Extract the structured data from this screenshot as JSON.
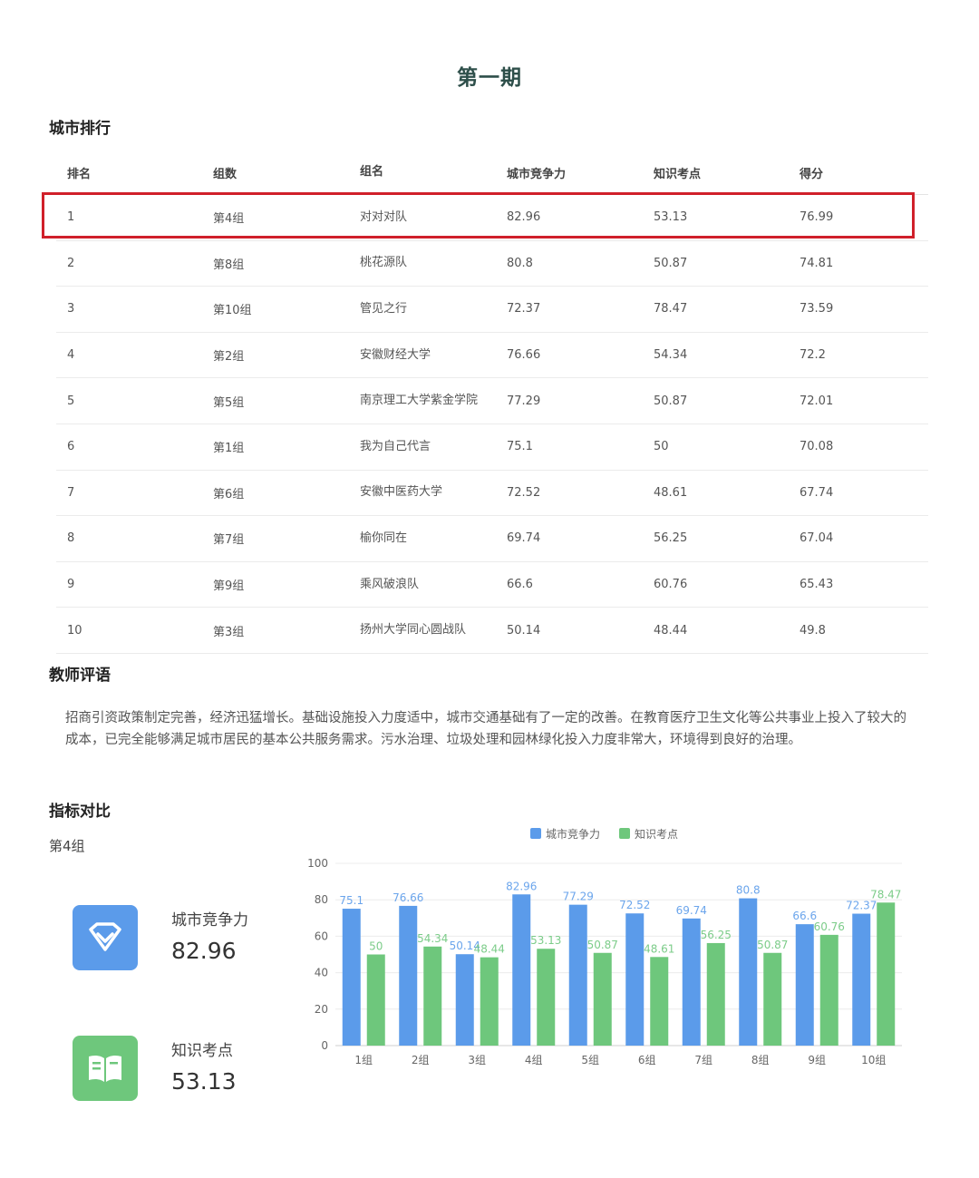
{
  "title": "第一期",
  "ranking": {
    "heading": "城市排行",
    "columns": [
      "排名",
      "组数",
      "组名",
      "城市竞争力",
      "知识考点",
      "得分"
    ],
    "rows": [
      [
        "1",
        "第4组",
        "对对对队",
        "82.96",
        "53.13",
        "76.99"
      ],
      [
        "2",
        "第8组",
        "桃花源队",
        "80.8",
        "50.87",
        "74.81"
      ],
      [
        "3",
        "第10组",
        "管见之行",
        "72.37",
        "78.47",
        "73.59"
      ],
      [
        "4",
        "第2组",
        "安徽财经大学",
        "76.66",
        "54.34",
        "72.2"
      ],
      [
        "5",
        "第5组",
        "南京理工大学紫金学院",
        "77.29",
        "50.87",
        "72.01"
      ],
      [
        "6",
        "第1组",
        "我为自己代言",
        "75.1",
        "50",
        "70.08"
      ],
      [
        "7",
        "第6组",
        "安徽中医药大学",
        "72.52",
        "48.61",
        "67.74"
      ],
      [
        "8",
        "第7组",
        "榆你同在",
        "69.74",
        "56.25",
        "67.04"
      ],
      [
        "9",
        "第9组",
        "乘风破浪队",
        "66.6",
        "60.76",
        "65.43"
      ],
      [
        "10",
        "第3组",
        "扬州大学同心圆战队",
        "50.14",
        "48.44",
        "49.8"
      ]
    ],
    "highlighted_row": 1,
    "highlight_color": "#d0202a"
  },
  "comment": {
    "heading": "教师评语",
    "text": "招商引资政策制定完善，经济迅猛增长。基础设施投入力度适中，城市交通基础有了一定的改善。在教育医疗卫生文化等公共事业上投入了较大的成本，已完全能够满足城市居民的基本公共服务需求。污水治理、垃圾处理和园林绿化投入力度非常大，环境得到良好的治理。"
  },
  "comparison": {
    "heading": "指标对比",
    "group": "第4组",
    "metrics": [
      {
        "label": "城市竞争力",
        "value": "82.96",
        "icon": "diamond-icon",
        "color": "#5b9bea"
      },
      {
        "label": "知识考点",
        "value": "53.13",
        "icon": "book-icon",
        "color": "#6ec77c"
      }
    ]
  },
  "chart_data": {
    "type": "bar",
    "categories": [
      "1组",
      "2组",
      "3组",
      "4组",
      "5组",
      "6组",
      "7组",
      "8组",
      "9组",
      "10组"
    ],
    "series": [
      {
        "name": "城市竞争力",
        "color": "#5b9bea",
        "values": [
          75.1,
          76.66,
          50.14,
          82.96,
          77.29,
          72.52,
          69.74,
          80.8,
          66.6,
          72.37
        ]
      },
      {
        "name": "知识考点",
        "color": "#6ec77c",
        "values": [
          50,
          54.34,
          48.44,
          53.13,
          50.87,
          48.61,
          56.25,
          50.87,
          60.76,
          78.47
        ]
      }
    ],
    "ylim": [
      0,
      100
    ],
    "yticks": [
      0,
      20,
      40,
      60,
      80,
      100
    ],
    "legend": "top-center",
    "grid": true,
    "data_labels": true
  }
}
